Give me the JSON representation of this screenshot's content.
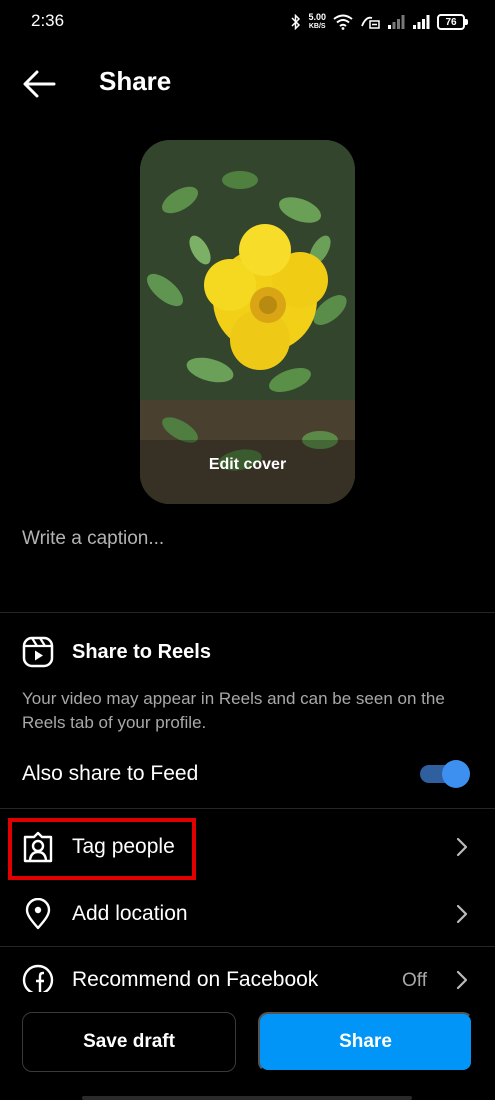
{
  "status_bar": {
    "time": "2:36",
    "net_speed": "5.00",
    "net_unit": "KB/S",
    "battery": "76"
  },
  "header": {
    "title": "Share",
    "back_icon": "arrow-left-icon"
  },
  "preview": {
    "edit_cover_label": "Edit cover"
  },
  "caption": {
    "placeholder": "Write a caption..."
  },
  "reels": {
    "title": "Share to Reels",
    "icon": "reels-icon",
    "description": "Your video may appear in Reels and can be seen on the Reels tab of your profile."
  },
  "feed": {
    "label": "Also share to Feed",
    "enabled": true,
    "accent": "#3d8ff0"
  },
  "rows": {
    "tag_people": {
      "label": "Tag people",
      "icon": "tag-person-icon"
    },
    "add_location": {
      "label": "Add location",
      "icon": "location-pin-icon"
    },
    "recommend_facebook": {
      "label": "Recommend on Facebook",
      "value": "Off",
      "icon": "facebook-icon"
    }
  },
  "actions": {
    "save_draft": "Save draft",
    "share": "Share",
    "share_color": "#0095f6"
  },
  "highlight_color": "#e00000"
}
